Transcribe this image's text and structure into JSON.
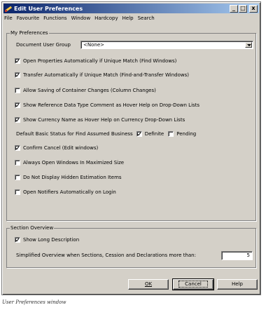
{
  "window": {
    "title": "Edit User Preferences",
    "controls": {
      "minimize": "_",
      "maximize": "□",
      "close": "x"
    }
  },
  "menu": [
    "File",
    "Favourite",
    "Functions",
    "Window",
    "Hardcopy",
    "Help",
    "Search"
  ],
  "my_preferences": {
    "group_label": "My Preferences",
    "doc_user_group_label": "Document User Group",
    "doc_user_group_value": "<None>",
    "options": [
      {
        "label": "Open Properties Automatically if Unique Match (Find Windows)",
        "checked": true
      },
      {
        "label": "Transfer Automatically if Unique Match (Find-and-Transfer Windows)",
        "checked": true
      },
      {
        "label": "Allow Saving of Container Changes (Column Changes)",
        "checked": false
      },
      {
        "label": "Show Reference Data Type Comment as Hover Help on Drop-Down Lists",
        "checked": true
      },
      {
        "label": "Show Currency Name as Hover Help on Currency Drop-Down Lists",
        "checked": true
      }
    ],
    "status_label": "Default Basic Status for Find Assumed Business",
    "status_definite": {
      "label": "Definite",
      "checked": true
    },
    "status_pending": {
      "label": "Pending",
      "checked": false
    },
    "options2": [
      {
        "label": "Confirm Cancel (Edit windows)",
        "checked": true
      },
      {
        "label": "Always Open Windows In Maximized Size",
        "checked": false
      },
      {
        "label": "Do Not Display Hidden Estimation Items",
        "checked": false
      },
      {
        "label": "Open Notifiers Automatically on Login",
        "checked": false
      }
    ]
  },
  "section_overview": {
    "group_label": "Section Overview",
    "show_long": {
      "label": "Show Long Description",
      "checked": true
    },
    "simplified_label": "Simplified Overview when Sections, Cession and Declarations more than:",
    "simplified_value": "5"
  },
  "buttons": {
    "ok": "OK",
    "cancel": "Cancel",
    "help": "Help"
  },
  "caption": "User Preferences window"
}
